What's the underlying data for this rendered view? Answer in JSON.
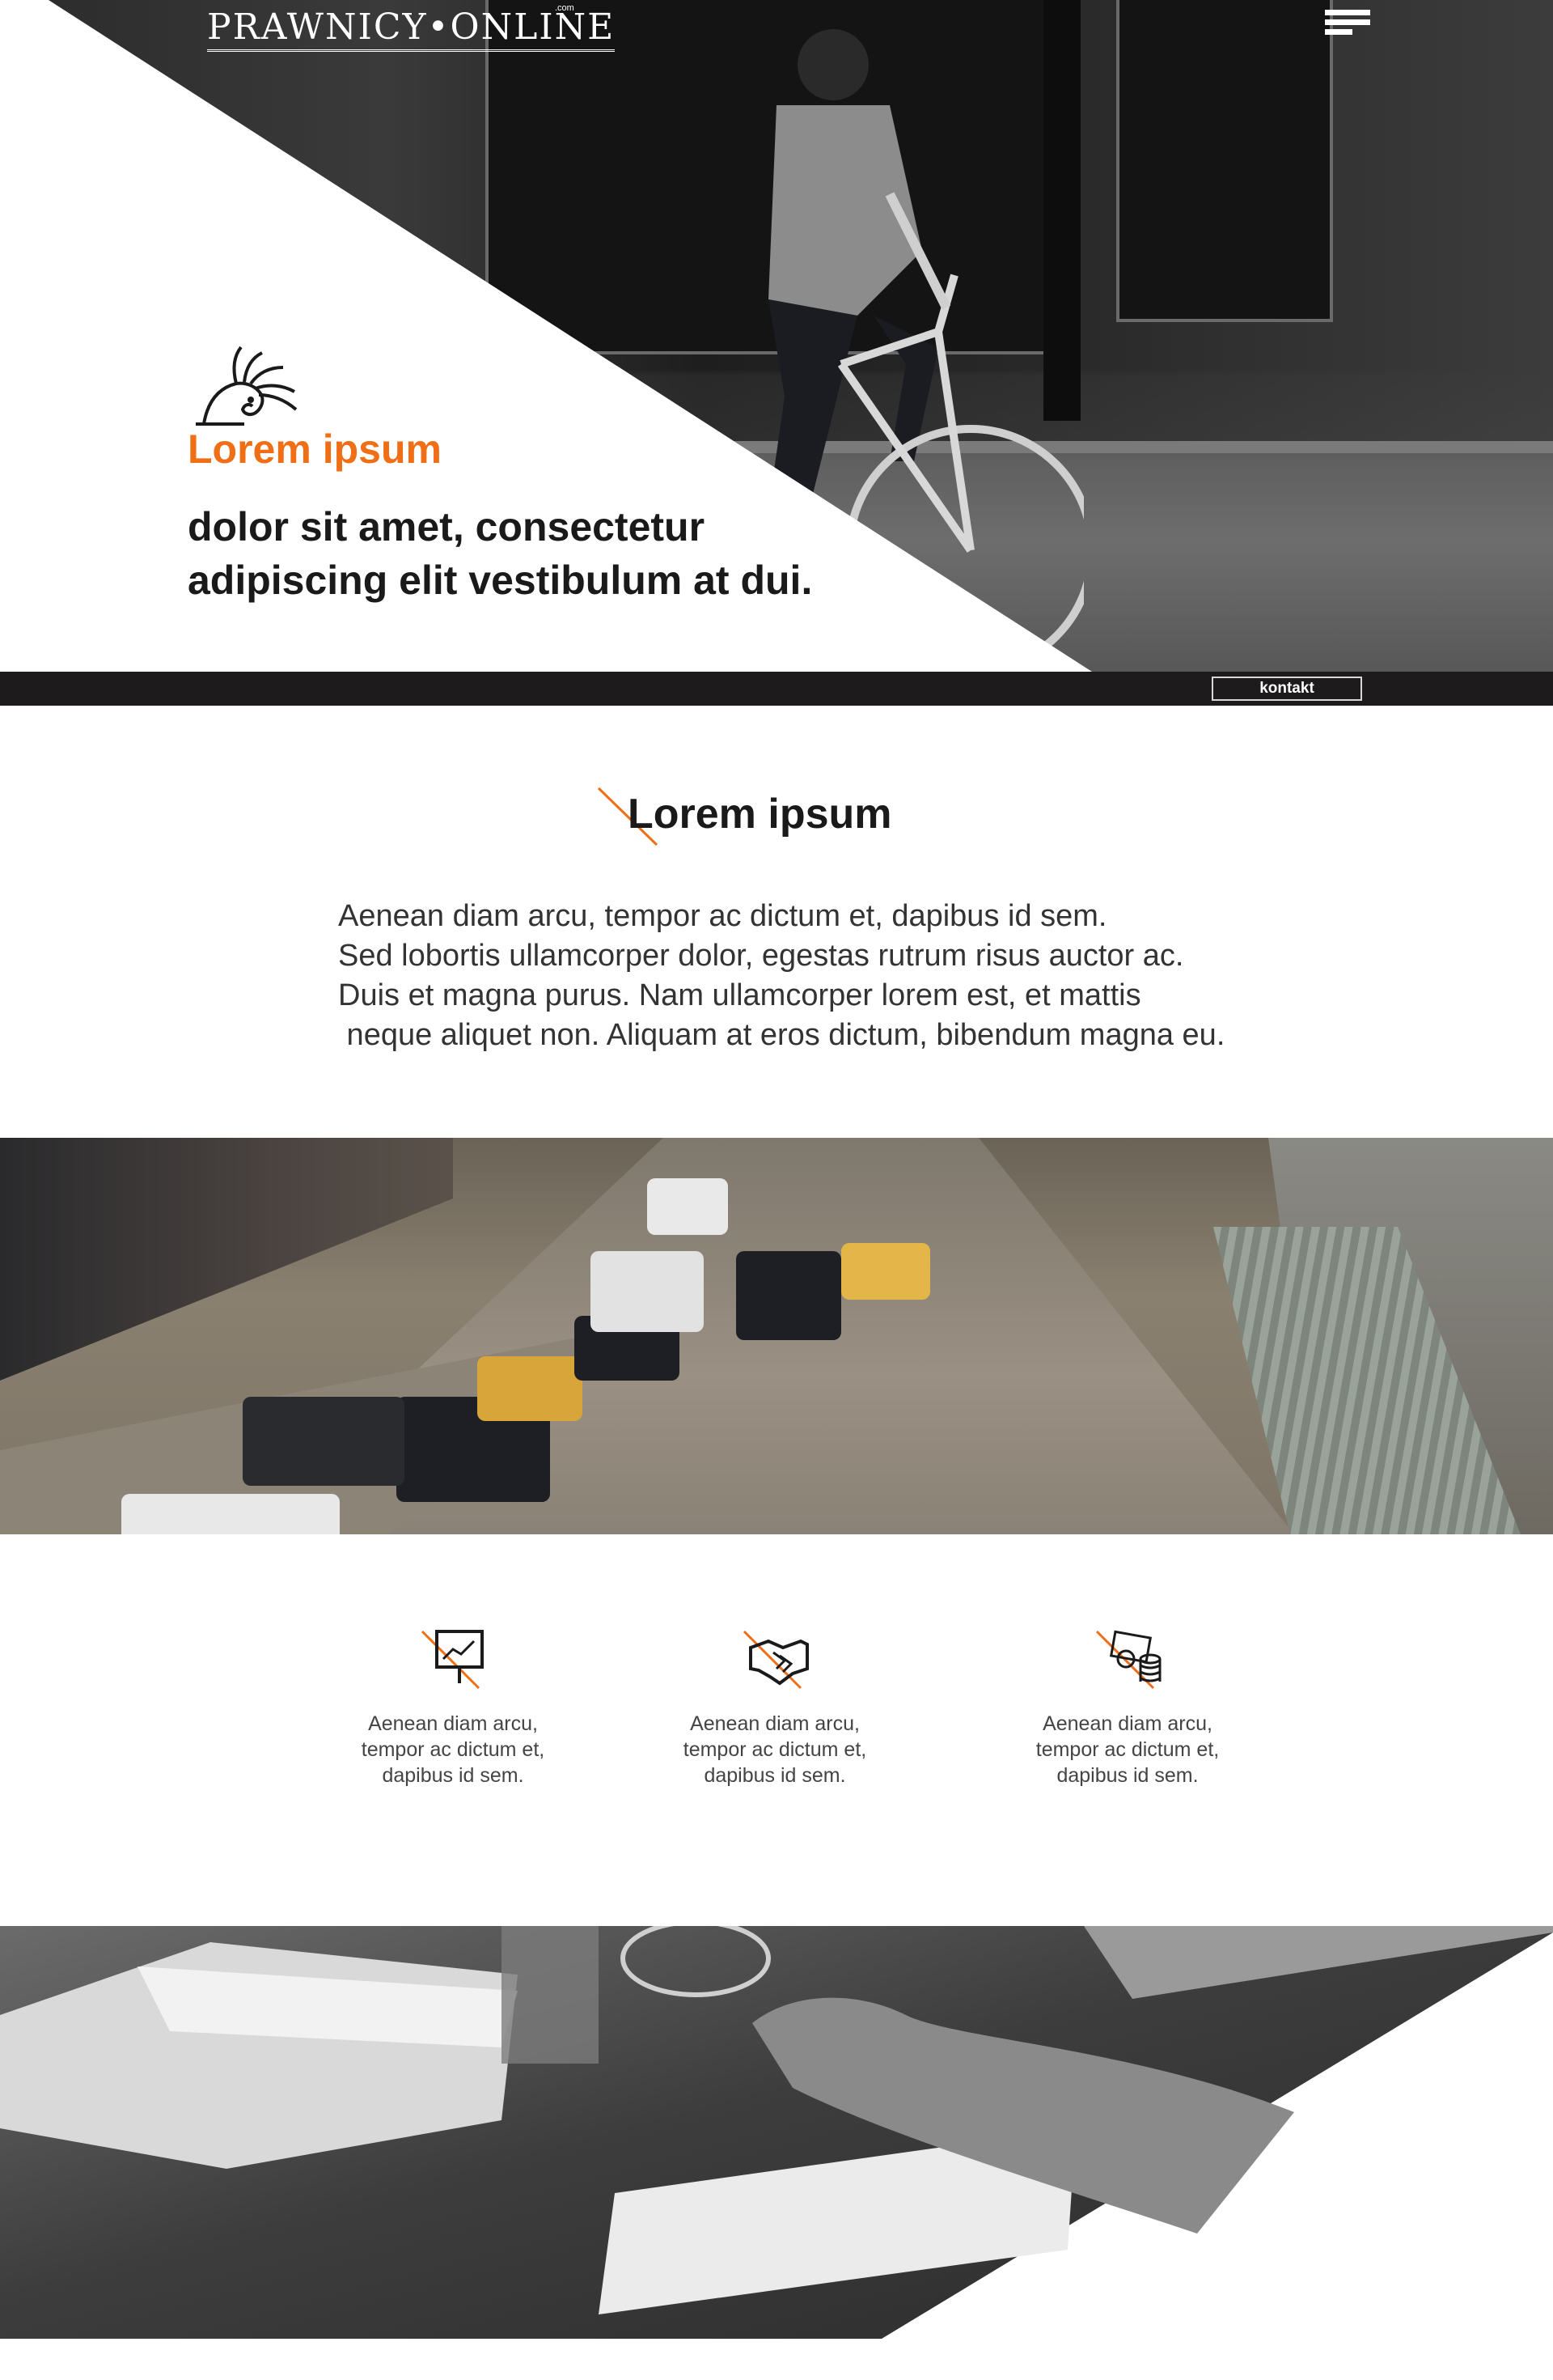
{
  "header": {
    "logo_text": "PRAWNICY•ONLINE",
    "logo_suffix": ".com"
  },
  "hero": {
    "title": "Lorem ipsum",
    "subtitle_line1": "dolor sit amet, consectetur",
    "subtitle_line2": "adipiscing elit vestibulum at dui."
  },
  "nav_bar": {
    "contact_label": "kontakt"
  },
  "intro": {
    "title": "Lorem ipsum",
    "lines": [
      "Aenean diam arcu, tempor ac dictum et, dapibus id sem.",
      "Sed lobortis ullamcorper dolor, egestas rutrum risus auctor ac.",
      "Duis et magna purus. Nam ullamcorper lorem est, et mattis",
      " neque aliquet non. Aliquam at eros dictum, bibendum magna eu."
    ]
  },
  "features": [
    {
      "icon": "presentation-chart-icon",
      "line1": "Aenean diam arcu,",
      "line2": "tempor ac dictum et,",
      "line3": "dapibus id sem."
    },
    {
      "icon": "handshake-icon",
      "line1": "Aenean diam arcu,",
      "line2": "tempor ac dictum et,",
      "line3": "dapibus id sem."
    },
    {
      "icon": "money-coins-icon",
      "line1": "Aenean diam arcu,",
      "line2": "tempor ac dictum et,",
      "line3": "dapibus id sem."
    }
  ],
  "colors": {
    "accent": "#f06e16",
    "dark_bar": "#1d1b1c",
    "text_dark": "#1a1a1a"
  }
}
